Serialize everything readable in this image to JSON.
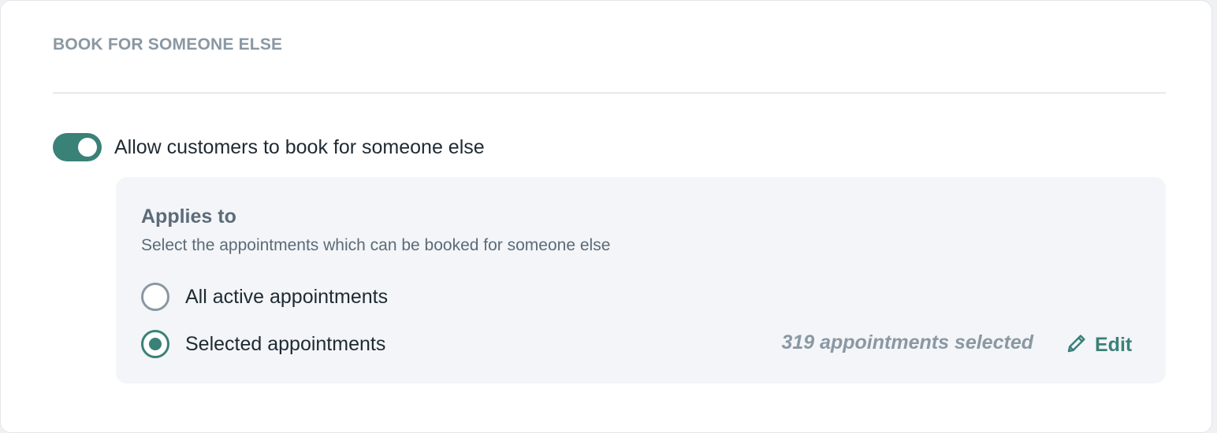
{
  "section": {
    "title": "BOOK FOR SOMEONE ELSE"
  },
  "toggle": {
    "label": "Allow customers to book for someone else",
    "enabled": true
  },
  "applies_to": {
    "title": "Applies to",
    "subtitle": "Select the appointments which can be booked for someone else",
    "options": [
      {
        "label": "All active appointments",
        "checked": false
      },
      {
        "label": "Selected appointments",
        "checked": true
      }
    ],
    "selected_count_text": "319 appointments selected",
    "edit_label": "Edit",
    "edit_icon": "pencil-icon"
  },
  "colors": {
    "accent": "#3a8178",
    "muted": "#8a98a3",
    "text": "#1f2a33",
    "panel_bg": "#f3f5f8"
  }
}
